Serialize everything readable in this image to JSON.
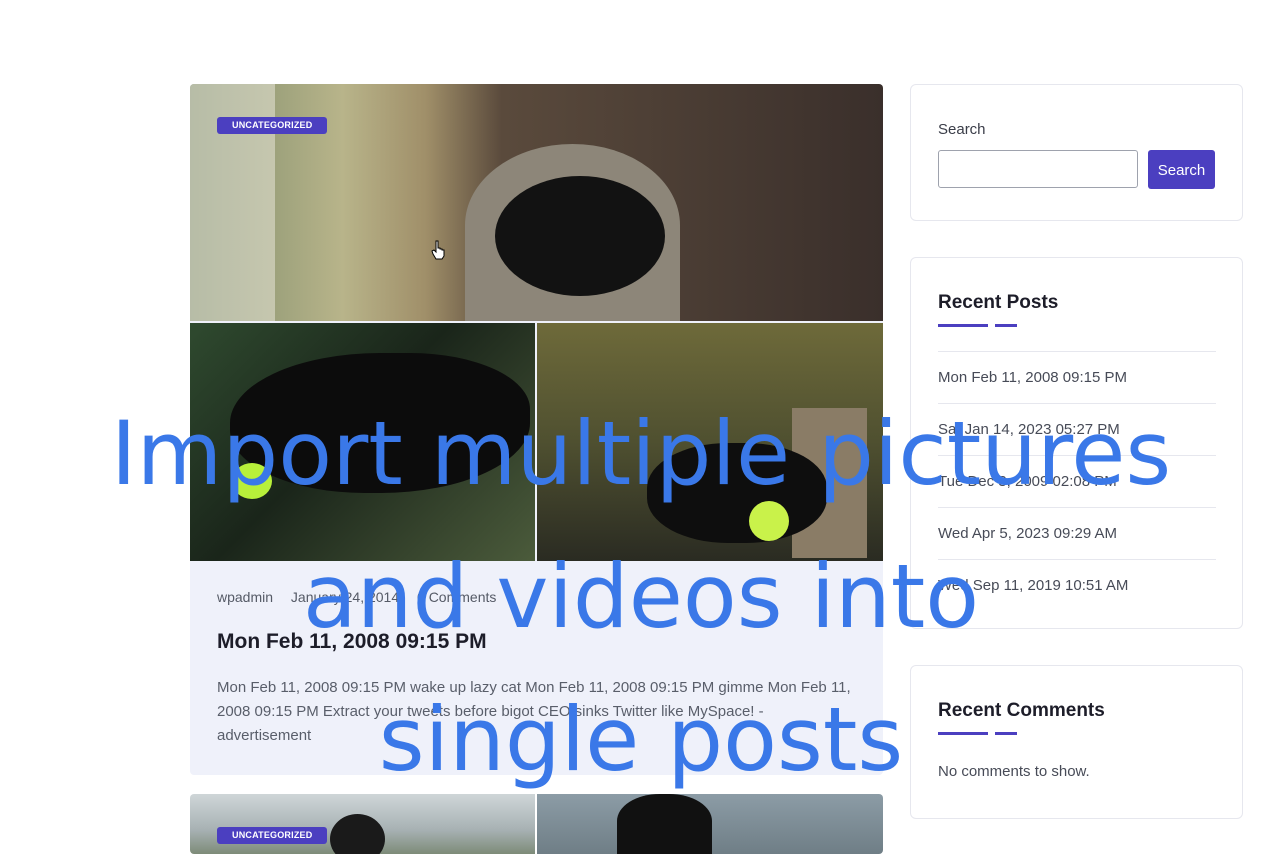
{
  "post": {
    "category": "UNCATEGORIZED",
    "author": "wpadmin",
    "date": "January 24, 2014",
    "comments": "0 Comments",
    "title": "Mon Feb 11, 2008 09:15 PM",
    "excerpt": "Mon Feb 11, 2008 09:15 PM wake up lazy cat Mon Feb 11, 2008 09:15 PM gimme Mon Feb 11, 2008 09:15 PM Extract your tweets before bigot CEO sinks Twitter like MySpace! - advertisement"
  },
  "next_post": {
    "category": "UNCATEGORIZED"
  },
  "sidebar": {
    "search": {
      "label": "Search",
      "button": "Search",
      "placeholder": ""
    },
    "recent_posts": {
      "title": "Recent Posts",
      "items": [
        "Mon Feb 11, 2008 09:15 PM",
        "Sat Jan 14, 2023 05:27 PM",
        "Tue Dec 8, 2009 02:08 PM",
        "Wed Apr 5, 2023 09:29 AM",
        "Wed Sep 11, 2019 10:51 AM"
      ]
    },
    "recent_comments": {
      "title": "Recent Comments",
      "empty": "No comments to show."
    }
  },
  "overlay": {
    "lines": [
      "Import multiple pictures",
      "and videos into",
      "single posts"
    ]
  },
  "colors": {
    "accent": "#4b3fc0",
    "overlay_text": "#3a78e8",
    "card_bg": "#eff1fa"
  }
}
